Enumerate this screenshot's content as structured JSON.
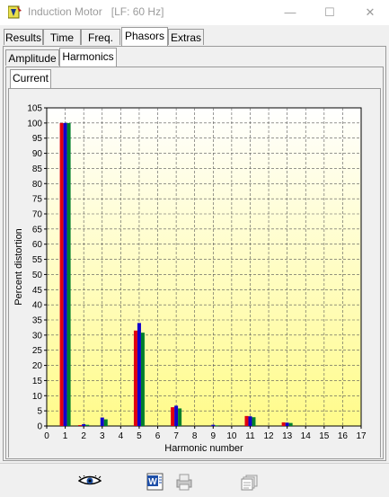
{
  "window": {
    "title": "Induction Motor",
    "subtitle": "[LF: 60 Hz]",
    "minimize_glyph": "—",
    "maximize_glyph": "☐",
    "close_glyph": "✕"
  },
  "main_tabs": [
    {
      "label": "Results",
      "selected": false
    },
    {
      "label": "Time",
      "selected": false
    },
    {
      "label": "Freq.",
      "selected": false
    },
    {
      "label": "Phasors",
      "selected": true
    },
    {
      "label": "Extras",
      "selected": false
    }
  ],
  "sub_tabs": [
    {
      "label": "Amplitude",
      "selected": false
    },
    {
      "label": "Harmonics",
      "selected": true
    }
  ],
  "quantity_tabs": [
    {
      "label": "Current",
      "selected": true
    }
  ],
  "chart_data": {
    "type": "bar",
    "xlabel": "Harmonic number",
    "ylabel": "Percent distortion",
    "xlim": [
      0,
      17
    ],
    "ylim": [
      0,
      105
    ],
    "xticks": [
      0,
      1,
      2,
      3,
      4,
      5,
      6,
      7,
      8,
      9,
      10,
      11,
      12,
      13,
      14,
      15,
      16,
      17
    ],
    "yticks": [
      0,
      5,
      10,
      15,
      20,
      25,
      30,
      35,
      40,
      45,
      50,
      55,
      60,
      65,
      70,
      75,
      80,
      85,
      90,
      95,
      100,
      105
    ],
    "grid": true,
    "background": "yellow-gradient",
    "categories": [
      1,
      2,
      3,
      5,
      7,
      9,
      11,
      13
    ],
    "series": [
      {
        "color": "#e0000f",
        "values": [
          100,
          0.3,
          0,
          31.5,
          6.2,
          0,
          3.3,
          1.2
        ]
      },
      {
        "color": "#1100cc",
        "values": [
          100,
          0.6,
          2.8,
          34.0,
          6.7,
          0.4,
          3.2,
          1.1
        ]
      },
      {
        "color": "#00802b",
        "values": [
          100,
          0.4,
          2.2,
          30.8,
          5.8,
          0.2,
          2.9,
          1.0
        ]
      }
    ]
  },
  "toolbar": {
    "icons": [
      "eye-icon",
      "word-export-icon",
      "print-icon",
      "copy-pages-icon"
    ]
  },
  "colors": {
    "plot_top": "#ffffff",
    "plot_bottom": "#fffb8a",
    "grid": "#555555"
  }
}
